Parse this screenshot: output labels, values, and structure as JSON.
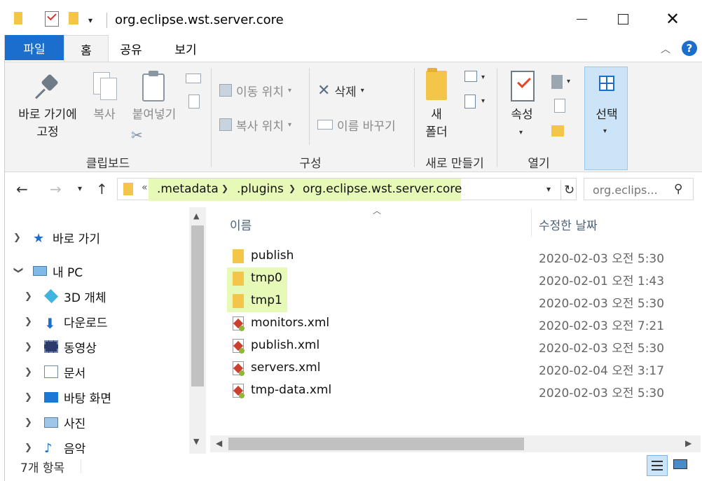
{
  "window": {
    "title": "org.eclipse.wst.server.core"
  },
  "ribbon_tabs": [
    "파일",
    "홈",
    "공유",
    "보기"
  ],
  "ribbon": {
    "clipboard": {
      "pin_label_1": "바로 가기에",
      "pin_label_2": "고정",
      "copy_label": "복사",
      "paste_label": "붙여넣기",
      "group_label": "클립보드"
    },
    "organize": {
      "move_label": "이동 위치",
      "copy_label": "복사 위치",
      "delete_label": "삭제",
      "rename_label": "이름 바꾸기",
      "group_label": "구성"
    },
    "new": {
      "folder_label_1": "새",
      "folder_label_2": "폴더",
      "group_label": "새로 만들기"
    },
    "open": {
      "props_label": "속성",
      "group_label": "열기"
    },
    "select": {
      "label": "선택"
    }
  },
  "address": {
    "overflow": "«",
    "crumbs": [
      ".metadata",
      ".plugins",
      "org.eclipse.wst.server.core"
    ],
    "search_placeholder": "org.eclips..."
  },
  "nav_tree": [
    {
      "label": "바로 가기",
      "icon": "star-icon",
      "expanded": false
    },
    {
      "label": "내 PC",
      "icon": "pc-icon",
      "expanded": true
    },
    {
      "label": "3D 개체",
      "icon": "cube-icon",
      "expanded": false
    },
    {
      "label": "다운로드",
      "icon": "download-icon",
      "expanded": false
    },
    {
      "label": "동영상",
      "icon": "video-icon",
      "expanded": false
    },
    {
      "label": "문서",
      "icon": "document-icon",
      "expanded": false
    },
    {
      "label": "바탕 화면",
      "icon": "desktop-icon",
      "expanded": false
    },
    {
      "label": "사진",
      "icon": "picture-icon",
      "expanded": false
    },
    {
      "label": "음악",
      "icon": "music-icon",
      "expanded": false
    }
  ],
  "file_list": {
    "headers": {
      "name": "이름",
      "date": "수정한 날짜"
    },
    "rows": [
      {
        "name": "publish",
        "date": "2020-02-03 오전 5:30",
        "type": "folder",
        "highlight": false
      },
      {
        "name": "tmp0",
        "date": "2020-02-01 오전 1:43",
        "type": "folder",
        "highlight": true
      },
      {
        "name": "tmp1",
        "date": "2020-02-03 오전 5:30",
        "type": "folder",
        "highlight": true
      },
      {
        "name": "monitors.xml",
        "date": "2020-02-03 오전 7:21",
        "type": "xml",
        "highlight": false
      },
      {
        "name": "publish.xml",
        "date": "2020-02-03 오전 5:30",
        "type": "xml",
        "highlight": false
      },
      {
        "name": "servers.xml",
        "date": "2020-02-04 오전 3:17",
        "type": "xml",
        "highlight": false
      },
      {
        "name": "tmp-data.xml",
        "date": "2020-02-03 오전 5:30",
        "type": "xml",
        "highlight": false
      }
    ]
  },
  "status": {
    "item_count": "7개 항목"
  },
  "colors": {
    "accent": "#1a6ecd",
    "highlight": "#e6f9b7",
    "folder": "#f3c64a"
  }
}
